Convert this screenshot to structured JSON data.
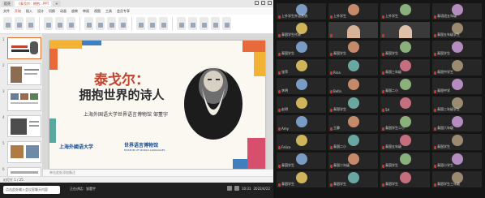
{
  "app": {
    "tabs": [
      {
        "label": "稻壳"
      },
      {
        "label": "《泰戈尔：拥抱…PPT"
      },
      {
        "label": "+"
      }
    ],
    "menu": [
      "文件",
      "开始",
      "插入",
      "设计",
      "切换",
      "动画",
      "放映",
      "审阅",
      "视图",
      "工具",
      "会员专享"
    ],
    "active_menu_index": 1
  },
  "thumbnails": [
    {
      "num": "1"
    },
    {
      "num": "2"
    },
    {
      "num": "3"
    },
    {
      "num": "4"
    },
    {
      "num": "5"
    },
    {
      "num": "6"
    }
  ],
  "slide": {
    "title": "泰戈尔：",
    "subtitle": "拥抱世界的诗人",
    "author": "上海外国语大学世界语言博物馆  邹董宇",
    "logo_left": "上海外國语大学",
    "logo_right_title": "世界语言博物馆",
    "logo_right_sub": "MUSEUM OF WORLD LANGUAGES"
  },
  "notes_placeholder": "单击此处添加备注",
  "status_text": "幻灯片 1 / 25",
  "taskbar": {
    "input_placeholder": "点击此处输入会议室聊天内容",
    "controls": [
      "正在讲话：邹董宇"
    ],
    "time": "10:31",
    "date": "2022/4/22"
  },
  "tiles": [
    {
      "label": "上外学生外语营销"
    },
    {
      "label": "上外学生"
    },
    {
      "label": "上外学生"
    },
    {
      "label": "泰语班五年级"
    },
    {
      "label": "泰国学生代表"
    },
    {
      "label": ""
    },
    {
      "label": ""
    },
    {
      "label": "泰国五年级学生"
    },
    {
      "label": "泰国学生"
    },
    {
      "label": "泰国学生"
    },
    {
      "label": "泰国学生"
    },
    {
      "label": "泰国学生"
    },
    {
      "label": "张萍"
    },
    {
      "label": "Rina"
    },
    {
      "label": "泰国三年级"
    },
    {
      "label": "泰国中学生"
    },
    {
      "label": "李明"
    },
    {
      "label": "Bella"
    },
    {
      "label": "泰国二小"
    },
    {
      "label": "泰国中学"
    },
    {
      "label": "赵明"
    },
    {
      "label": "泰国学生"
    },
    {
      "label": "5A"
    },
    {
      "label": "泰国三年级学生"
    },
    {
      "label": "Amy"
    },
    {
      "label": "王静"
    },
    {
      "label": "泰国学生二小"
    },
    {
      "label": "泰国六年级"
    },
    {
      "label": "Felice"
    },
    {
      "label": "泰国二小"
    },
    {
      "label": "泰国五年级"
    },
    {
      "label": "泰国学生"
    },
    {
      "label": "泰国学生"
    },
    {
      "label": "泰国二年级"
    },
    {
      "label": "泰国学生"
    },
    {
      "label": "泰国小学生"
    },
    {
      "label": "泰国学生"
    },
    {
      "label": "泰国学生"
    },
    {
      "label": "泰国学生"
    },
    {
      "label": "泰国学生三年级"
    }
  ]
}
